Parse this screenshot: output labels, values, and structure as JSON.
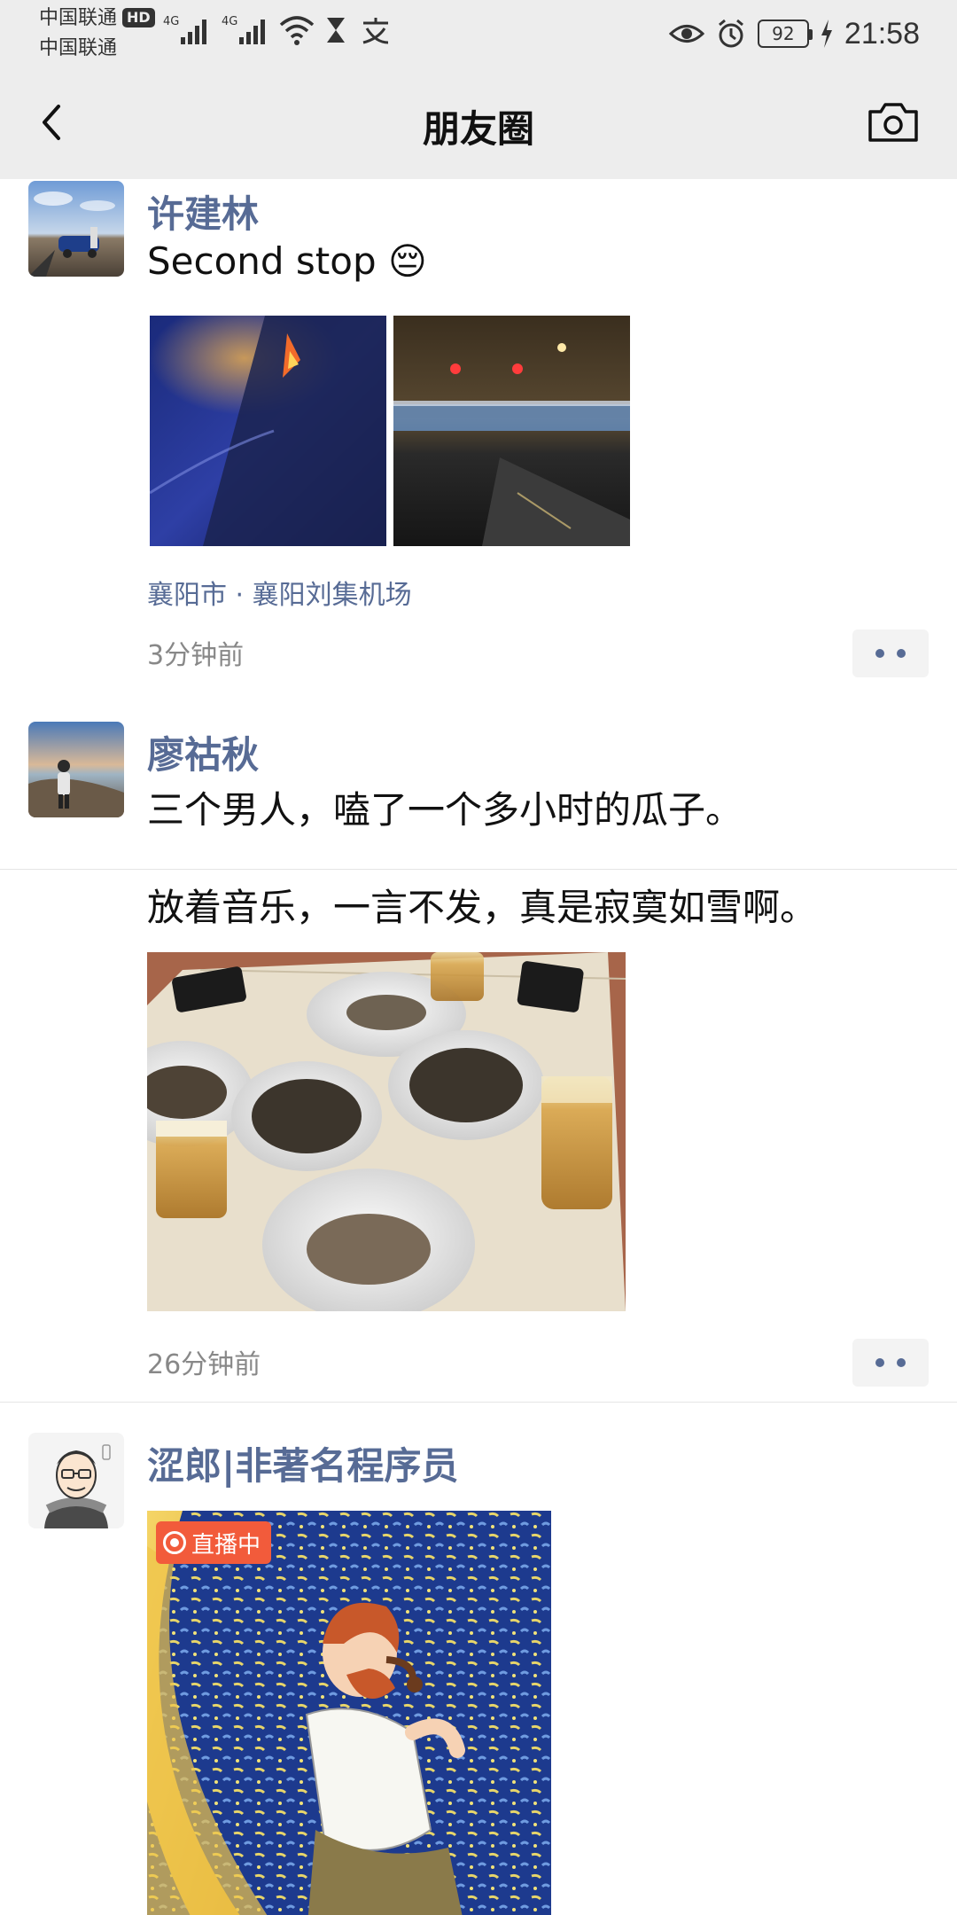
{
  "status_bar": {
    "carrier_1": "中国联通",
    "hd_label": "HD",
    "carrier_2": "中国联通",
    "network_1": "4G",
    "network_2": "4G",
    "battery": "92",
    "time": "21:58"
  },
  "nav": {
    "title": "朋友圈"
  },
  "posts": [
    {
      "name": "许建林",
      "text": "Second stop 😔",
      "location": "襄阳市 · 襄阳刘集机场",
      "time": "3分钟前"
    },
    {
      "name": "廖祜秋",
      "text_line_1": "三个男人，嗑了一个多小时的瓜子。",
      "text_line_2": "放着音乐，一言不发，真是寂寞如雪啊。",
      "time": "26分钟前"
    },
    {
      "name": "涩郎|非著名程序员",
      "live_label": "直播中"
    }
  ],
  "colors": {
    "name_blue": "#576b95",
    "nav_bg": "#ededed",
    "live_red": "#f25b3b"
  }
}
